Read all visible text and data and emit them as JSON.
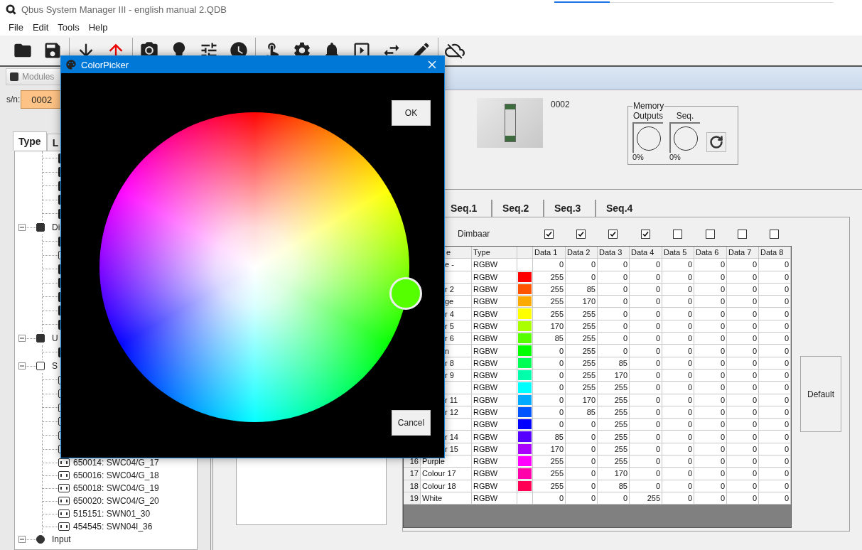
{
  "app": {
    "title": "Qbus System Manager III - english manual 2.QDB"
  },
  "menu": [
    "File",
    "Edit",
    "Tools",
    "Help"
  ],
  "modules_panel": {
    "title": "Modules",
    "serial_label": "s/n:",
    "serial_value": "0002",
    "tabs": [
      {
        "label": "Type",
        "selected": true
      },
      {
        "label": "L",
        "selected": false
      }
    ],
    "tree": {
      "leading": [
        {
          "kind": "dark"
        },
        {
          "kind": "dark"
        },
        {
          "kind": "dark"
        },
        {
          "kind": "dark"
        },
        {
          "kind": "dark"
        }
      ],
      "groups": [
        {
          "kind": "module",
          "label": "Di",
          "expanded": true,
          "children": [
            {
              "kind": "dark"
            },
            {
              "kind": "outline"
            },
            {
              "kind": "dark"
            },
            {
              "kind": "dark"
            },
            {
              "kind": "dark"
            },
            {
              "kind": "dark"
            },
            {
              "kind": "dark"
            }
          ]
        },
        {
          "kind": "power",
          "label": "U",
          "expanded": true,
          "children": [
            {
              "kind": "dark"
            }
          ]
        },
        {
          "kind": "switch",
          "label": "S",
          "expanded": true,
          "children": [
            {
              "kind": "outline"
            },
            {
              "kind": "outline"
            },
            {
              "kind": "outline"
            },
            {
              "kind": "outline"
            },
            {
              "kind": "outline"
            },
            {
              "kind": "outline"
            },
            {
              "kind": "outline",
              "label": "650014: SWC04/G_17"
            },
            {
              "kind": "outline",
              "label": "650016: SWC04/G_18"
            },
            {
              "kind": "outline",
              "label": "650018: SWC04/G_19"
            },
            {
              "kind": "outline",
              "label": "650020: SWC04/G_20"
            },
            {
              "kind": "outline",
              "label": "515151: SWN01_30"
            },
            {
              "kind": "outline",
              "label": "454545: SWN04I_36"
            }
          ]
        },
        {
          "kind": "input",
          "label": "Input",
          "expanded": true
        }
      ]
    }
  },
  "module": {
    "serial": "0002",
    "memory": {
      "title": "Memory",
      "gauges": [
        {
          "label": "Outputs",
          "reading": "0%"
        },
        {
          "label": "Seq.",
          "reading": "0%"
        }
      ]
    }
  },
  "tabs": [
    {
      "label": "Seq.1",
      "selected": false
    },
    {
      "label": "Seq.2",
      "selected": false
    },
    {
      "label": "Seq.3",
      "selected": false
    },
    {
      "label": "Seq.4",
      "selected": false
    }
  ],
  "dimbaar": {
    "label": "Dimbaar",
    "checks": [
      {
        "checked": true
      },
      {
        "checked": true
      },
      {
        "checked": true
      },
      {
        "checked": true
      },
      {
        "checked": false
      },
      {
        "checked": false
      },
      {
        "checked": false
      },
      {
        "checked": false
      }
    ]
  },
  "table": {
    "columns": [
      {
        "kind": "name",
        "label": "e"
      },
      {
        "kind": "type",
        "label": "Type"
      },
      {
        "kind": "color"
      },
      {
        "kind": "data",
        "label": "Data 1"
      },
      {
        "kind": "data",
        "label": "Data 2"
      },
      {
        "kind": "data",
        "label": "Data 3"
      },
      {
        "kind": "data",
        "label": "Data 4"
      },
      {
        "kind": "data",
        "label": "Data 5"
      },
      {
        "kind": "data",
        "label": "Data 6"
      },
      {
        "kind": "data",
        "label": "Data 7"
      },
      {
        "kind": "data",
        "label": "Data 8"
      }
    ],
    "rows": [
      {
        "name": "e -",
        "type": "RGBW",
        "data": [
          "0",
          "0",
          "0",
          "0",
          "0",
          "0",
          "0",
          "0"
        ]
      },
      {
        "type": "RGBW",
        "color": "#ff0000",
        "data": [
          "255",
          "0",
          "0",
          "0",
          "0",
          "0",
          "0",
          "0"
        ]
      },
      {
        "name": "r 2",
        "type": "RGBW",
        "color": "#ff5500",
        "data": [
          "255",
          "85",
          "0",
          "0",
          "0",
          "0",
          "0",
          "0"
        ]
      },
      {
        "name": "ge",
        "type": "RGBW",
        "color": "#ffaa00",
        "data": [
          "255",
          "170",
          "0",
          "0",
          "0",
          "0",
          "0",
          "0"
        ]
      },
      {
        "name": "r 4",
        "type": "RGBW",
        "color": "#ffff00",
        "data": [
          "255",
          "255",
          "0",
          "0",
          "0",
          "0",
          "0",
          "0"
        ]
      },
      {
        "name": "r 5",
        "type": "RGBW",
        "color": "#aaff00",
        "data": [
          "170",
          "255",
          "0",
          "0",
          "0",
          "0",
          "0",
          "0"
        ]
      },
      {
        "name": "r 6",
        "type": "RGBW",
        "color": "#55ff00",
        "data": [
          "85",
          "255",
          "0",
          "0",
          "0",
          "0",
          "0",
          "0"
        ]
      },
      {
        "name": "n",
        "type": "RGBW",
        "color": "#00ff00",
        "data": [
          "0",
          "255",
          "0",
          "0",
          "0",
          "0",
          "0",
          "0"
        ]
      },
      {
        "name": "r 8",
        "type": "RGBW",
        "color": "#00ff55",
        "data": [
          "0",
          "255",
          "85",
          "0",
          "0",
          "0",
          "0",
          "0"
        ]
      },
      {
        "name": "r 9",
        "type": "RGBW",
        "color": "#00ffaa",
        "data": [
          "0",
          "255",
          "170",
          "0",
          "0",
          "0",
          "0",
          "0"
        ]
      },
      {
        "type": "RGBW",
        "color": "#00ffff",
        "data": [
          "0",
          "255",
          "255",
          "0",
          "0",
          "0",
          "0",
          "0"
        ]
      },
      {
        "name": "r 11",
        "type": "RGBW",
        "color": "#00aaff",
        "data": [
          "0",
          "170",
          "255",
          "0",
          "0",
          "0",
          "0",
          "0"
        ]
      },
      {
        "name": "r 12",
        "type": "RGBW",
        "color": "#0055ff",
        "data": [
          "0",
          "85",
          "255",
          "0",
          "0",
          "0",
          "0",
          "0"
        ]
      },
      {
        "type": "RGBW",
        "color": "#0000ff",
        "data": [
          "0",
          "0",
          "255",
          "0",
          "0",
          "0",
          "0",
          "0"
        ]
      },
      {
        "name": "r 14",
        "type": "RGBW",
        "color": "#5500ff",
        "data": [
          "85",
          "0",
          "255",
          "0",
          "0",
          "0",
          "0",
          "0"
        ]
      },
      {
        "name": "r 15",
        "type": "RGBW",
        "color": "#aa00ff",
        "data": [
          "170",
          "0",
          "255",
          "0",
          "0",
          "0",
          "0",
          "0"
        ]
      },
      {
        "num": "16",
        "name": "Purple",
        "type": "RGBW",
        "color": "#ff00ff",
        "data": [
          "255",
          "0",
          "255",
          "0",
          "0",
          "0",
          "0",
          "0"
        ]
      },
      {
        "num": "17",
        "name": "Colour 17",
        "type": "RGBW",
        "color": "#ff00aa",
        "data": [
          "255",
          "0",
          "170",
          "0",
          "0",
          "0",
          "0",
          "0"
        ]
      },
      {
        "num": "18",
        "name": "Colour 18",
        "type": "RGBW",
        "color": "#ff0055",
        "data": [
          "255",
          "0",
          "85",
          "0",
          "0",
          "0",
          "0",
          "0"
        ]
      },
      {
        "num": "19",
        "name": "White",
        "type": "RGBW",
        "data": [
          "0",
          "0",
          "0",
          "255",
          "0",
          "0",
          "0",
          "0"
        ]
      }
    ]
  },
  "default_button": "Default",
  "color_picker": {
    "title": "ColorPicker",
    "ok": "OK",
    "cancel": "Cancel"
  }
}
